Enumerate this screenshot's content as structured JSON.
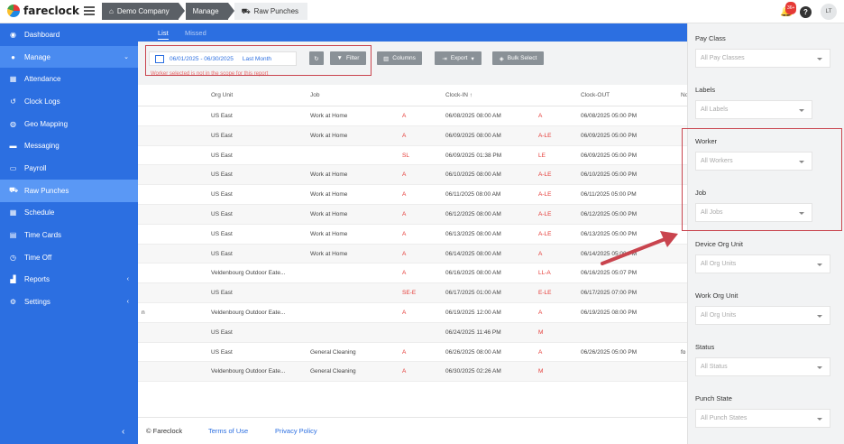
{
  "brand": {
    "name": "fareclock"
  },
  "breadcrumbs": [
    "Demo Company",
    "Manage",
    "Raw Punches"
  ],
  "topbar": {
    "notification_count": "36+",
    "avatar_initials": "LT"
  },
  "sidebar": {
    "items": [
      {
        "label": "Dashboard",
        "icon": "dashboard-icon"
      },
      {
        "label": "Manage",
        "icon": "user-icon"
      },
      {
        "label": "Attendance",
        "icon": "attendance-icon"
      },
      {
        "label": "Clock Logs",
        "icon": "history-icon"
      },
      {
        "label": "Geo Mapping",
        "icon": "globe-icon"
      },
      {
        "label": "Messaging",
        "icon": "chat-icon"
      },
      {
        "label": "Payroll",
        "icon": "money-icon"
      },
      {
        "label": "Raw Punches",
        "icon": "truck-icon"
      },
      {
        "label": "Schedule",
        "icon": "calendar-icon"
      },
      {
        "label": "Time Cards",
        "icon": "card-icon"
      },
      {
        "label": "Time Off",
        "icon": "clock-icon"
      },
      {
        "label": "Reports",
        "icon": "chart-icon"
      },
      {
        "label": "Settings",
        "icon": "gear-icon"
      }
    ]
  },
  "tabs": {
    "list": "List",
    "missed": "Missed"
  },
  "toolbar": {
    "date_range": "06/01/2025 - 06/30/2025",
    "preset": "Last Month",
    "filter": "Filter",
    "columns": "Columns",
    "export": "Export",
    "bulk_select": "Bulk Select",
    "error_text": "Worker selected is not in the scope for this report"
  },
  "table": {
    "headers": {
      "org_unit": "Org Unit",
      "job": "Job",
      "clock_in": "Clock-IN",
      "clock_out": "Clock-OUT",
      "note": "No"
    },
    "rows": [
      {
        "first": "",
        "org": "US East",
        "job": "Work at Home",
        "in_flag": "A",
        "clock_in": "06/08/2025 08:00 AM",
        "out_flag": "A",
        "clock_out": "06/08/2025 05:00 PM",
        "note": ""
      },
      {
        "first": "",
        "org": "US East",
        "job": "Work at Home",
        "in_flag": "A",
        "clock_in": "06/09/2025 08:00 AM",
        "out_flag": "A-LE",
        "clock_out": "06/09/2025 05:00 PM",
        "note": ""
      },
      {
        "first": "",
        "org": "US East",
        "job": "",
        "in_flag": "SL",
        "clock_in": "06/09/2025 01:38 PM",
        "out_flag": "LE",
        "clock_out": "06/09/2025 05:00 PM",
        "note": ""
      },
      {
        "first": "",
        "org": "US East",
        "job": "Work at Home",
        "in_flag": "A",
        "clock_in": "06/10/2025 08:00 AM",
        "out_flag": "A-LE",
        "clock_out": "06/10/2025 05:00 PM",
        "note": ""
      },
      {
        "first": "",
        "org": "US East",
        "job": "Work at Home",
        "in_flag": "A",
        "clock_in": "06/11/2025 08:00 AM",
        "out_flag": "A-LE",
        "clock_out": "06/11/2025 05:00 PM",
        "note": ""
      },
      {
        "first": "",
        "org": "US East",
        "job": "Work at Home",
        "in_flag": "A",
        "clock_in": "06/12/2025 08:00 AM",
        "out_flag": "A-LE",
        "clock_out": "06/12/2025 05:00 PM",
        "note": ""
      },
      {
        "first": "",
        "org": "US East",
        "job": "Work at Home",
        "in_flag": "A",
        "clock_in": "06/13/2025 08:00 AM",
        "out_flag": "A-LE",
        "clock_out": "06/13/2025 05:00 PM",
        "note": ""
      },
      {
        "first": "",
        "org": "US East",
        "job": "Work at Home",
        "in_flag": "A",
        "clock_in": "06/14/2025 08:00 AM",
        "out_flag": "A",
        "clock_out": "06/14/2025 05:00 PM",
        "note": ""
      },
      {
        "first": "",
        "org": "Veldenbourg Outdoor Eate...",
        "job": "",
        "in_flag": "A",
        "clock_in": "06/16/2025 08:00 AM",
        "out_flag": "LL-A",
        "clock_out": "06/16/2025 05:07 PM",
        "note": ""
      },
      {
        "first": "",
        "org": "US East",
        "job": "",
        "in_flag": "SE-E",
        "clock_in": "06/17/2025 01:00 AM",
        "out_flag": "E-LE",
        "clock_out": "06/17/2025 07:00 PM",
        "note": ""
      },
      {
        "first": "n",
        "org": "Veldenbourg Outdoor Eate...",
        "job": "",
        "in_flag": "A",
        "clock_in": "06/19/2025 12:00 AM",
        "out_flag": "A",
        "clock_out": "06/19/2025 08:00 PM",
        "note": ""
      },
      {
        "first": "",
        "org": "US East",
        "job": "",
        "in_flag": "",
        "clock_in": "06/24/2025 11:46 PM",
        "out_flag": "M",
        "clock_out": "",
        "note": ""
      },
      {
        "first": "",
        "org": "US East",
        "job": "General Cleaning",
        "in_flag": "A",
        "clock_in": "06/26/2025 08:00 AM",
        "out_flag": "A",
        "clock_out": "06/26/2025 05:00 PM",
        "note": "fo"
      },
      {
        "first": "",
        "org": "Veldenbourg Outdoor Eate...",
        "job": "General Cleaning",
        "in_flag": "A",
        "clock_in": "06/30/2025 02:26 AM",
        "out_flag": "M",
        "clock_out": "",
        "note": ""
      }
    ]
  },
  "footer": {
    "copyright": "© Fareclock",
    "terms": "Terms of Use",
    "privacy": "Privacy Policy"
  },
  "filters": [
    {
      "label": "Pay Class",
      "placeholder": "All Pay Classes"
    },
    {
      "label": "Labels",
      "placeholder": "All Labels"
    },
    {
      "label": "Worker",
      "placeholder": "All Workers"
    },
    {
      "label": "Job",
      "placeholder": "All Jobs"
    },
    {
      "label": "Device Org Unit",
      "placeholder": "All Org Units"
    },
    {
      "label": "Work Org Unit",
      "placeholder": "All Org Units"
    },
    {
      "label": "Status",
      "placeholder": "All Status"
    },
    {
      "label": "Punch State",
      "placeholder": "All Punch States"
    }
  ],
  "colors": {
    "primary": "#2c6fe1",
    "highlight": "#c9444e",
    "flag": "#e53935"
  }
}
